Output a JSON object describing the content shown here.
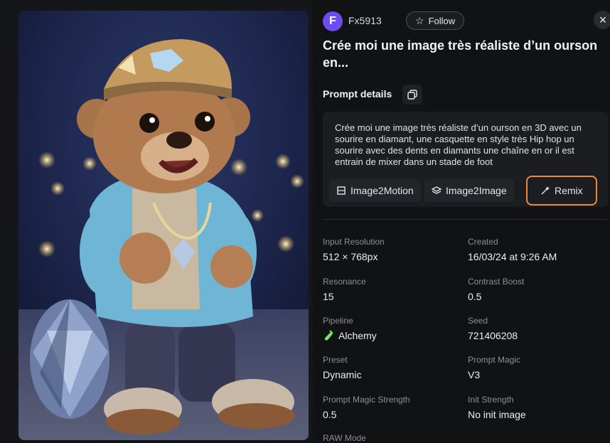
{
  "header": {
    "avatar_letter": "F",
    "username": "Fx5913",
    "follow_label": "Follow",
    "close_label": "×"
  },
  "title": "Crée moi une image très réaliste d’un ourson en...",
  "prompt": {
    "section_label": "Prompt details",
    "text": "Crée moi une image très réaliste d’un ourson en 3D avec un sourire en diamant, une casquette en style très Hip hop un sourire avec des dents en diamants une chaîne en or il est entrain de mixer dans un stade de foot",
    "buttons": {
      "image2motion": "Image2Motion",
      "image2image": "Image2Image",
      "remix": "Remix"
    }
  },
  "details": [
    {
      "key": "Input Resolution",
      "value": "512 × 768px"
    },
    {
      "key": "Created",
      "value": "16/03/24 at 9:26 AM"
    },
    {
      "key": "Resonance",
      "value": "15"
    },
    {
      "key": "Contrast Boost",
      "value": "0.5"
    },
    {
      "key": "Pipeline",
      "value": "Alchemy"
    },
    {
      "key": "Seed",
      "value": "721406208"
    },
    {
      "key": "Preset",
      "value": "Dynamic"
    },
    {
      "key": "Prompt Magic",
      "value": "V3"
    },
    {
      "key": "Prompt Magic Strength",
      "value": "0.5"
    },
    {
      "key": "Init Strength",
      "value": "No init image"
    },
    {
      "key": "RAW Mode",
      "value": ""
    }
  ],
  "colors": {
    "accent_avatar": "#6b4df0",
    "remix_highlight": "#f08a34",
    "alchemy_icon": "#7ee36a"
  }
}
